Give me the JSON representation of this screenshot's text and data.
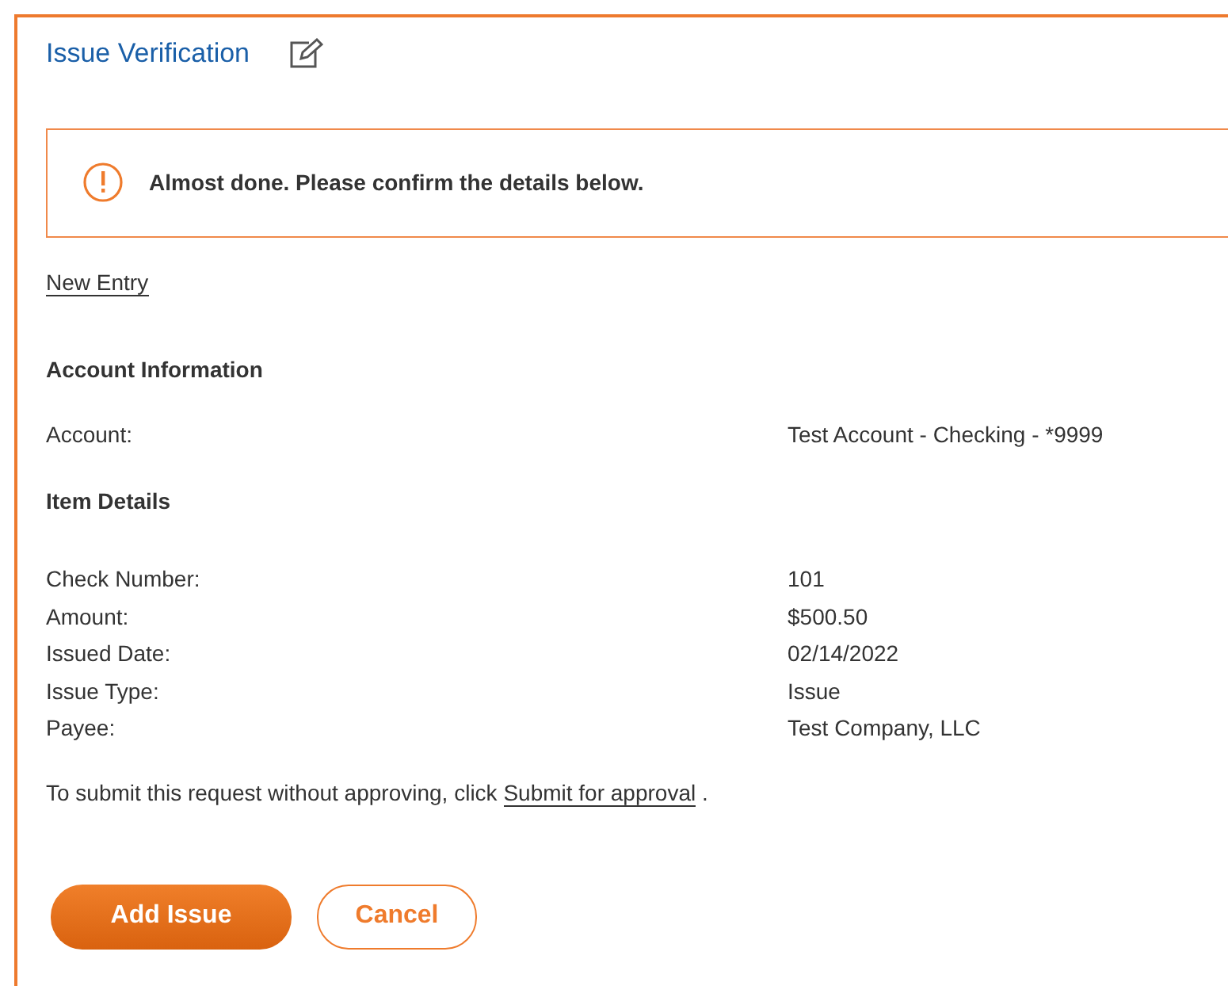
{
  "title": "Issue Verification",
  "alert": {
    "message": "Almost done. Please confirm the details below."
  },
  "new_entry_link": "New Entry",
  "sections": [
    {
      "heading": "Account Information",
      "rows": [
        {
          "label": "Account:",
          "value": "Test Account - Checking - *9999"
        }
      ]
    },
    {
      "heading": "Item Details",
      "rows": [
        {
          "label": "Check Number:",
          "value": "101"
        },
        {
          "label": "Amount:",
          "value": "$500.50"
        },
        {
          "label": "Issued Date:",
          "value": "02/14/2022"
        },
        {
          "label": "Issue Type:",
          "value": "Issue"
        },
        {
          "label": "Payee:",
          "value": "Test Company, LLC"
        }
      ]
    }
  ],
  "submit_note": {
    "before": "To submit this request without approving, click",
    "link": "Submit for approval",
    "after": "."
  },
  "buttons": [
    {
      "label": "Add Issue",
      "kind": "primary"
    },
    {
      "label": "Cancel",
      "kind": "secondary"
    }
  ]
}
